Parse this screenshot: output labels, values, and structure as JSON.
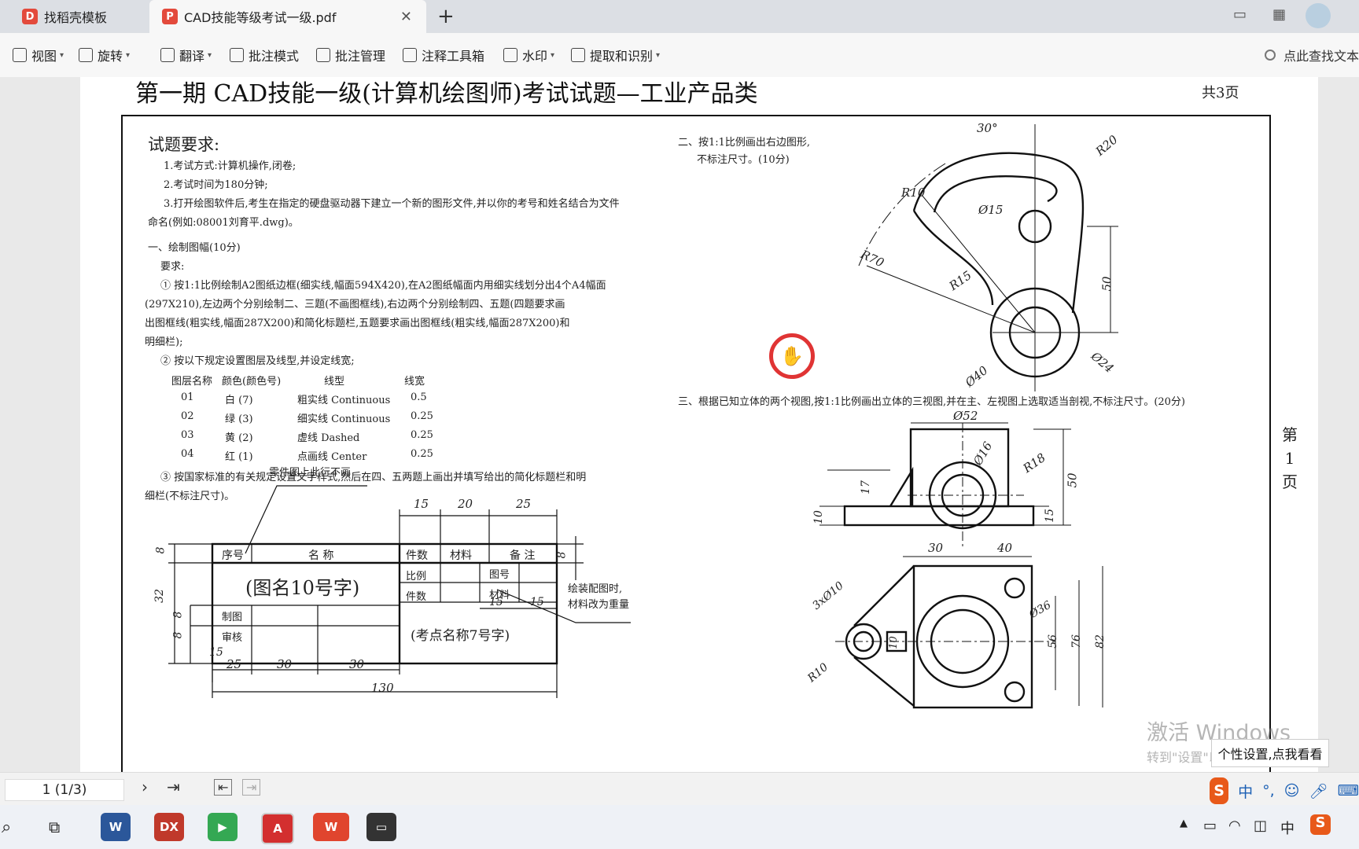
{
  "tabs": [
    {
      "label": "找稻壳模板",
      "icon": "docer-icon"
    },
    {
      "label": "CAD技能等级考试一级.pdf",
      "icon": "pdf-icon"
    }
  ],
  "toolbar": {
    "items": [
      {
        "label": "视图",
        "icon": "view-icon",
        "caret": true
      },
      {
        "label": "旋转",
        "icon": "rotate-icon",
        "caret": true
      },
      {
        "label": "翻译",
        "icon": "translate-icon",
        "caret": true
      },
      {
        "label": "批注模式",
        "icon": "annotate-mode-icon",
        "caret": false
      },
      {
        "label": "批注管理",
        "icon": "annotate-manage-icon",
        "caret": false
      },
      {
        "label": "注释工具箱",
        "icon": "toolbox-icon",
        "caret": false
      },
      {
        "label": "水印",
        "icon": "watermark-icon",
        "caret": true
      },
      {
        "label": "提取和识别",
        "icon": "extract-icon",
        "caret": true
      }
    ],
    "search_label": "点此查找文本"
  },
  "pdf": {
    "title": "第一期 CAD技能一级(计算机绘图师)考试试题—工业产品类",
    "total_pages_label": "共3页",
    "side_page_label": [
      "第",
      "1",
      "页"
    ],
    "requirements_heading": "试题要求:",
    "requirements": [
      "1.考试方式:计算机操作,闭卷;",
      "2.考试时间为180分钟;",
      "3.打开绘图软件后,考生在指定的硬盘驱动器下建立一个新的图形文件,并以你的考号和姓名结合为文件",
      "命名(例如:08001刘育平.dwg)。"
    ],
    "section1_title": "一、绘制图幅(10分)",
    "section1_sub": "要求:",
    "section1_items": [
      "① 按1:1比例绘制A2图纸边框(细实线,幅面594X420),在A2图纸幅面内用细实线划分出4个A4幅面",
      "(297X210),左边两个分别绘制二、三题(不画图框线),右边两个分别绘制四、五题(四题要求画",
      "出图框线(粗实线,幅面287X200)和简化标题栏,五题要求画出图框线(粗实线,幅面287X200)和",
      "明细栏);",
      "② 按以下规定设置图层及线型,并设定线宽;"
    ],
    "layers_header": [
      "图层名称",
      "颜色(颜色号)",
      "线型",
      "线宽"
    ],
    "layers": [
      [
        "01",
        "白 (7)",
        "粗实线 Continuous",
        "0.5"
      ],
      [
        "02",
        "绿 (3)",
        "细实线 Continuous",
        "0.25"
      ],
      [
        "03",
        "黄 (2)",
        "虚线 Dashed",
        "0.25"
      ],
      [
        "04",
        "红 (1)",
        "点画线 Center",
        "0.25"
      ]
    ],
    "section1_item3": [
      "③ 按国家标准的有关规定设置文字样式,然后在四、五两题上画出并填写给出的简化标题栏和明",
      "细栏(不标注尺寸)。"
    ],
    "title_block": {
      "note_top": "零件图上此行不画",
      "seq": "序号",
      "name": "名 称",
      "qty": "件数",
      "material": "材料",
      "remarks": "备 注",
      "drawing_name": "(图名10号字)",
      "scale": "比例",
      "drawing_no": "图号",
      "pieces": "件数",
      "mat2": "材料",
      "drawn": "制图",
      "checked": "审核",
      "school": "(考点名称7号字)",
      "side_note1": "绘装配图时,",
      "side_note2": "材料改为重量",
      "dims": [
        "15",
        "20",
        "25",
        "8",
        "32",
        "8",
        "8",
        "8",
        "15",
        "15",
        "15",
        "25",
        "30",
        "130"
      ]
    },
    "section2": [
      "二、按1:1比例画出右边图形,",
      "不标注尺寸。(10分)"
    ],
    "section2_dims": [
      "30°",
      "R20",
      "R10",
      "Ø15",
      "R70",
      "R15",
      "50",
      "Ø40",
      "Ø24"
    ],
    "section3": "三、根据已知立体的两个视图,按1:1比例画出立体的三视图,并在主、左视图上选取适当剖视,不标注尺寸。(20分)",
    "section3_dims": [
      "Ø52",
      "Ø16",
      "R18",
      "17",
      "50",
      "10",
      "15",
      "30",
      "40",
      "3xØ10",
      "Ø36",
      "10",
      "56",
      "76",
      "82",
      "R10"
    ]
  },
  "pagenav": {
    "current": "1 (1/3)"
  },
  "watermark": {
    "line1": "激活 Windows",
    "line2": "转到\"设置\"以激活 Windows。"
  },
  "popup": "个性设置,点我看看",
  "ime": {
    "lang": "中"
  },
  "tray": {
    "lang": "中"
  }
}
